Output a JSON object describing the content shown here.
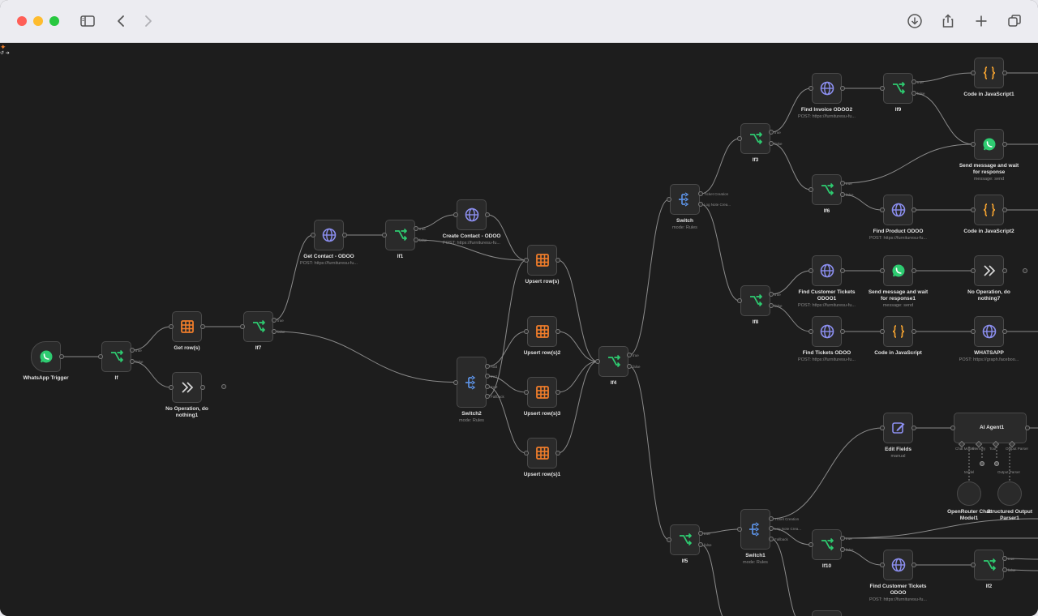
{
  "theme": {
    "canvas_bg": "#1d1d1d",
    "node_bg": "#2a2a2a",
    "node_border": "#4a4a4a",
    "edge_color": "#8a8a8a",
    "icon_green": "#2ecc71",
    "icon_orange": "#f07d2a",
    "icon_blue": "#5b8fe0",
    "icon_purple": "#8c8ff0",
    "icon_yellow": "#f0a030",
    "traffic_red": "#ff5f57",
    "traffic_yellow": "#febc2e",
    "traffic_green": "#28c840"
  },
  "nodes": {
    "whatsapp_trigger": {
      "label": "WhatsApp Trigger",
      "icon": "whatsapp-icon"
    },
    "if": {
      "label": "If",
      "icon": "branch-icon"
    },
    "get_rows": {
      "label": "Get row(s)",
      "icon": "table-icon"
    },
    "no_op1": {
      "label_line1": "No Operation, do",
      "label_line2": "nothing1",
      "icon": "double-arrow-icon"
    },
    "if7": {
      "label": "If7",
      "icon": "branch-icon"
    },
    "get_contact": {
      "label": "Get Contact - ODOO",
      "sub": "POST: https://furnituresu-fu...",
      "icon": "globe-icon"
    },
    "if1": {
      "label": "If1",
      "icon": "branch-icon"
    },
    "create_contact": {
      "label": "Create Contact - ODOO",
      "sub": "POST: https://furnituresu-fu...",
      "icon": "globe-icon"
    },
    "upsert_rows": {
      "label": "Upsert row(s)",
      "icon": "table-icon"
    },
    "upsert_rows2": {
      "label": "Upsert row(s)2",
      "icon": "table-icon"
    },
    "upsert_rows3": {
      "label": "Upsert row(s)3",
      "icon": "table-icon"
    },
    "upsert_rows1": {
      "label": "Upsert row(s)1",
      "icon": "table-icon"
    },
    "switch2": {
      "label": "Switch2",
      "sub": "mode: Rules",
      "icon": "switch-icon"
    },
    "if4": {
      "label": "If4",
      "icon": "branch-icon"
    },
    "switch": {
      "label": "Switch",
      "sub": "mode: Rules",
      "icon": "switch-icon"
    },
    "if3": {
      "label": "If3",
      "icon": "branch-icon"
    },
    "find_invoice": {
      "label": "Find Invoice ODOO2",
      "sub": "POST: https://furnituresu-fu...",
      "icon": "globe-icon"
    },
    "if9": {
      "label": "If9",
      "icon": "branch-icon"
    },
    "code_js1": {
      "label": "Code in JavaScript1",
      "icon": "code-icon"
    },
    "send_msg": {
      "label_line1": "Send message and wait",
      "label_line2": "for response",
      "sub": "message: send",
      "icon": "whatsapp-icon"
    },
    "if6": {
      "label": "If6",
      "icon": "branch-icon"
    },
    "find_product": {
      "label": "Find Product ODOO",
      "sub": "POST: https://furnituresu-fu...",
      "icon": "globe-icon"
    },
    "code_js2": {
      "label": "Code in JavaScript2",
      "icon": "code-icon"
    },
    "find_cust_tickets1": {
      "label_line1": "Find Customer Tickets",
      "label_line2": "ODOO1",
      "sub": "POST: https://furnituresu-fu...",
      "icon": "globe-icon"
    },
    "send_msg1": {
      "label_line1": "Send message and wait",
      "label_line2": "for response1",
      "sub": "message: send",
      "icon": "whatsapp-icon"
    },
    "no_op7": {
      "label_line1": "No Operation, do",
      "label_line2": "nothing7",
      "icon": "double-arrow-icon"
    },
    "if8": {
      "label": "If8",
      "icon": "branch-icon"
    },
    "find_tickets": {
      "label": "Find Tickets ODOO",
      "sub": "POST: https://furnituresu-fu...",
      "icon": "globe-icon"
    },
    "code_js": {
      "label": "Code in JavaScript",
      "icon": "code-icon"
    },
    "whatsapp_http": {
      "label": "WHATSAPP",
      "sub": "POST: https://graph.faceboo...",
      "icon": "globe-icon"
    },
    "edit_fields": {
      "label": "Edit Fields",
      "sub": "manual",
      "icon": "pencil-icon"
    },
    "ai_agent": {
      "label": "AI Agent1",
      "icon": "robot-icon"
    },
    "openrouter": {
      "label_line1": "OpenRouter Chat",
      "label_line2": "Model1",
      "icon": "openrouter-icon"
    },
    "structured_parser": {
      "label_line1": "Structured Output",
      "label_line2": "Parser1",
      "icon": "braces-icon"
    },
    "if5": {
      "label": "If5",
      "icon": "branch-icon"
    },
    "switch1": {
      "label": "Switch1",
      "sub": "mode: Rules",
      "icon": "switch-icon"
    },
    "if10": {
      "label": "If10",
      "icon": "branch-icon"
    },
    "find_cust_tickets": {
      "label_line1": "Find Customer Tickets",
      "label_line2": "ODOO",
      "sub": "POST: https://furnituresu-fu...",
      "icon": "globe-icon"
    },
    "if2": {
      "label": "If2",
      "icon": "branch-icon"
    }
  },
  "port_labels": {
    "true": "true",
    "false": "false",
    "ticket_creation": "Ticket Creation",
    "log_note": "Log Note Crea...",
    "fallback": "Fallback",
    "sw2_out1": "Add",
    "sw2_out2": "Inv1",
    "sw2_out3": "Inv2",
    "chat_model": "Chat Model",
    "memory": "Memory",
    "tool": "Tool",
    "output_parser": "Output Parser",
    "model": "Model"
  }
}
